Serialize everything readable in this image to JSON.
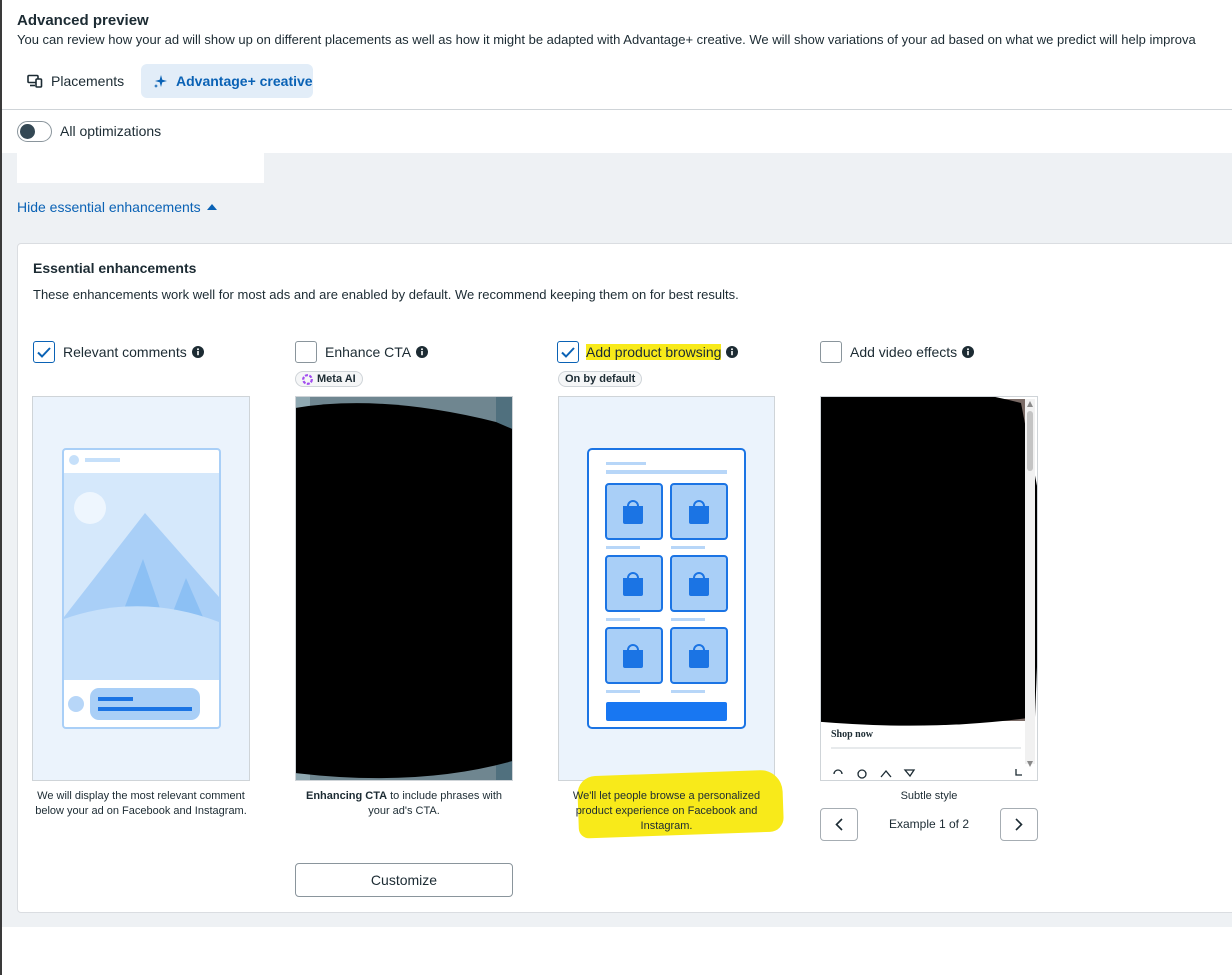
{
  "header": {
    "title": "Advanced preview",
    "subtitle": "You can review how your ad will show up on different placements as well as how it might be adapted with Advantage+ creative. We will show variations of your ad based on what we predict will help improva"
  },
  "tabs": {
    "placements": {
      "label": "Placements",
      "icon": "placements-icon"
    },
    "advantage": {
      "label": "Advantage+ creative",
      "icon": "sparkle-icon",
      "active": true
    }
  },
  "toggle": {
    "label": "All optimizations",
    "state": "off"
  },
  "hide_link": {
    "label": "Hide essential enhancements",
    "icon": "caret-up-icon"
  },
  "essential": {
    "title": "Essential enhancements",
    "description": "These enhancements work well for most ads and are enabled by default. We recommend keeping them on for best results.",
    "items": [
      {
        "label": "Relevant comments",
        "checked": true,
        "caption": "We will display the most relevant comment below your ad on Facebook and Instagram."
      },
      {
        "label": "Enhance CTA",
        "checked": false,
        "badge": "Meta AI",
        "caption_bold": "Enhancing CTA",
        "caption_rest": " to include phrases with your ad's CTA.",
        "button": "Customize"
      },
      {
        "label": "Add product browsing",
        "checked": true,
        "badge": "On by default",
        "caption": "We'll let people browse a personalized product experience on Facebook and Instagram."
      },
      {
        "label": "Add video effects",
        "checked": false,
        "preview_cta": "Shop now",
        "caption": "Subtle style",
        "pager": "Example 1 of 2"
      }
    ]
  },
  "colors": {
    "accent": "#0a62b5",
    "highlight": "#f8ea1a",
    "panel_bg": "#eef1f4",
    "illustration_blue": "#1877f2"
  }
}
